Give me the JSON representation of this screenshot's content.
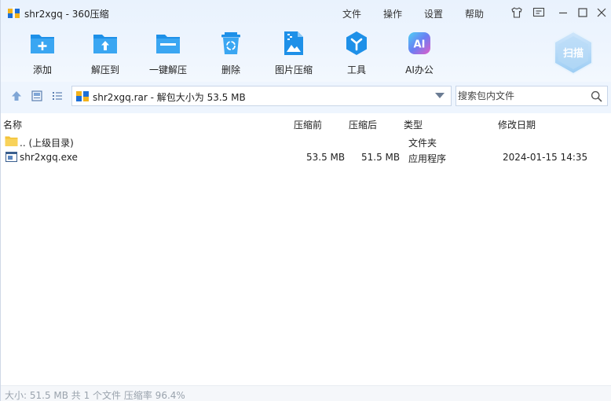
{
  "window": {
    "title": "shr2xgq - 360压缩"
  },
  "menu": {
    "file": "文件",
    "operate": "操作",
    "settings": "设置",
    "help": "帮助"
  },
  "toolbar": {
    "add": "添加",
    "extract_to": "解压到",
    "one_click_extract": "一键解压",
    "delete": "删除",
    "image_compress": "图片压缩",
    "tools": "工具",
    "ai_office": "AI办公",
    "ai_icon_text": "AI",
    "scan": "扫描"
  },
  "pathbar": {
    "path": "shr2xgq.rar - 解包大小为 53.5 MB",
    "search_placeholder": "搜索包内文件"
  },
  "columns": {
    "name": "名称",
    "compressed_before": "压缩前",
    "compressed_after": "压缩后",
    "type": "类型",
    "modified": "修改日期"
  },
  "files": [
    {
      "name": ".. (上级目录)",
      "before": "",
      "after": "",
      "type": "文件夹",
      "modified": "",
      "icon": "folder-icon"
    },
    {
      "name": "shr2xgq.exe",
      "before": "53.5 MB",
      "after": "51.5 MB",
      "type": "应用程序",
      "modified": "2024-01-15 14:35",
      "icon": "exe-icon"
    }
  ],
  "status": {
    "text": "大小: 51.5 MB 共 1 个文件 压缩率 96.4%"
  },
  "colors": {
    "accent": "#1a8de0",
    "toolbar_bg": "#eef5fe"
  }
}
